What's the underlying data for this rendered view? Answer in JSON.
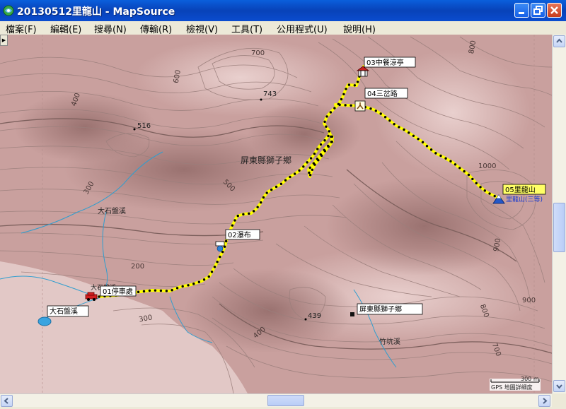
{
  "window": {
    "title": "20130512里龍山 - MapSource",
    "minimize": "minimize",
    "maximize": "maximize",
    "close": "close"
  },
  "menu": [
    {
      "label": "檔案(F)"
    },
    {
      "label": "編輯(E)"
    },
    {
      "label": "搜尋(N)"
    },
    {
      "label": "傳輸(R)"
    },
    {
      "label": "檢視(V)"
    },
    {
      "label": "工具(T)"
    },
    {
      "label": "公用程式(U)"
    },
    {
      "label": "說明(H)"
    }
  ],
  "map": {
    "colors": {
      "terrain": "#c9a09e",
      "contour": "#9b7f7c",
      "track": "#ffff00",
      "stream": "#2f9ecf",
      "label_bg": "#ffffff",
      "highlight_bg": "#ffff66"
    },
    "waypoints": [
      {
        "name": "01停車處",
        "icon": "car-icon"
      },
      {
        "name": "02瀑布",
        "icon": "waterfall-icon"
      },
      {
        "name": "03中餐涼亭",
        "icon": "pavilion-icon"
      },
      {
        "name": "04三岔路",
        "icon": "junction-icon"
      },
      {
        "name": "05里龍山",
        "icon": "summit-icon",
        "highlighted": true
      }
    ],
    "summit_name": "里龍山(三等)",
    "area_labels": [
      "屏東縣獅子鄉",
      "屏東縣獅子鄉"
    ],
    "streams": [
      "大石盤溪",
      "大石盤溪",
      "竹坑溪"
    ],
    "lake_label": "大石盤溪",
    "small_stream_label": "大石盤溪",
    "spot_heights": [
      "743",
      "516",
      "439"
    ],
    "contour_labels": [
      "700",
      "600",
      "400",
      "800",
      "300",
      "500",
      "200",
      "300",
      "400",
      "1000",
      "900",
      "800",
      "700",
      "900"
    ],
    "scale": {
      "value": "300 m",
      "detail": "GPS 地圖詳細度"
    }
  }
}
